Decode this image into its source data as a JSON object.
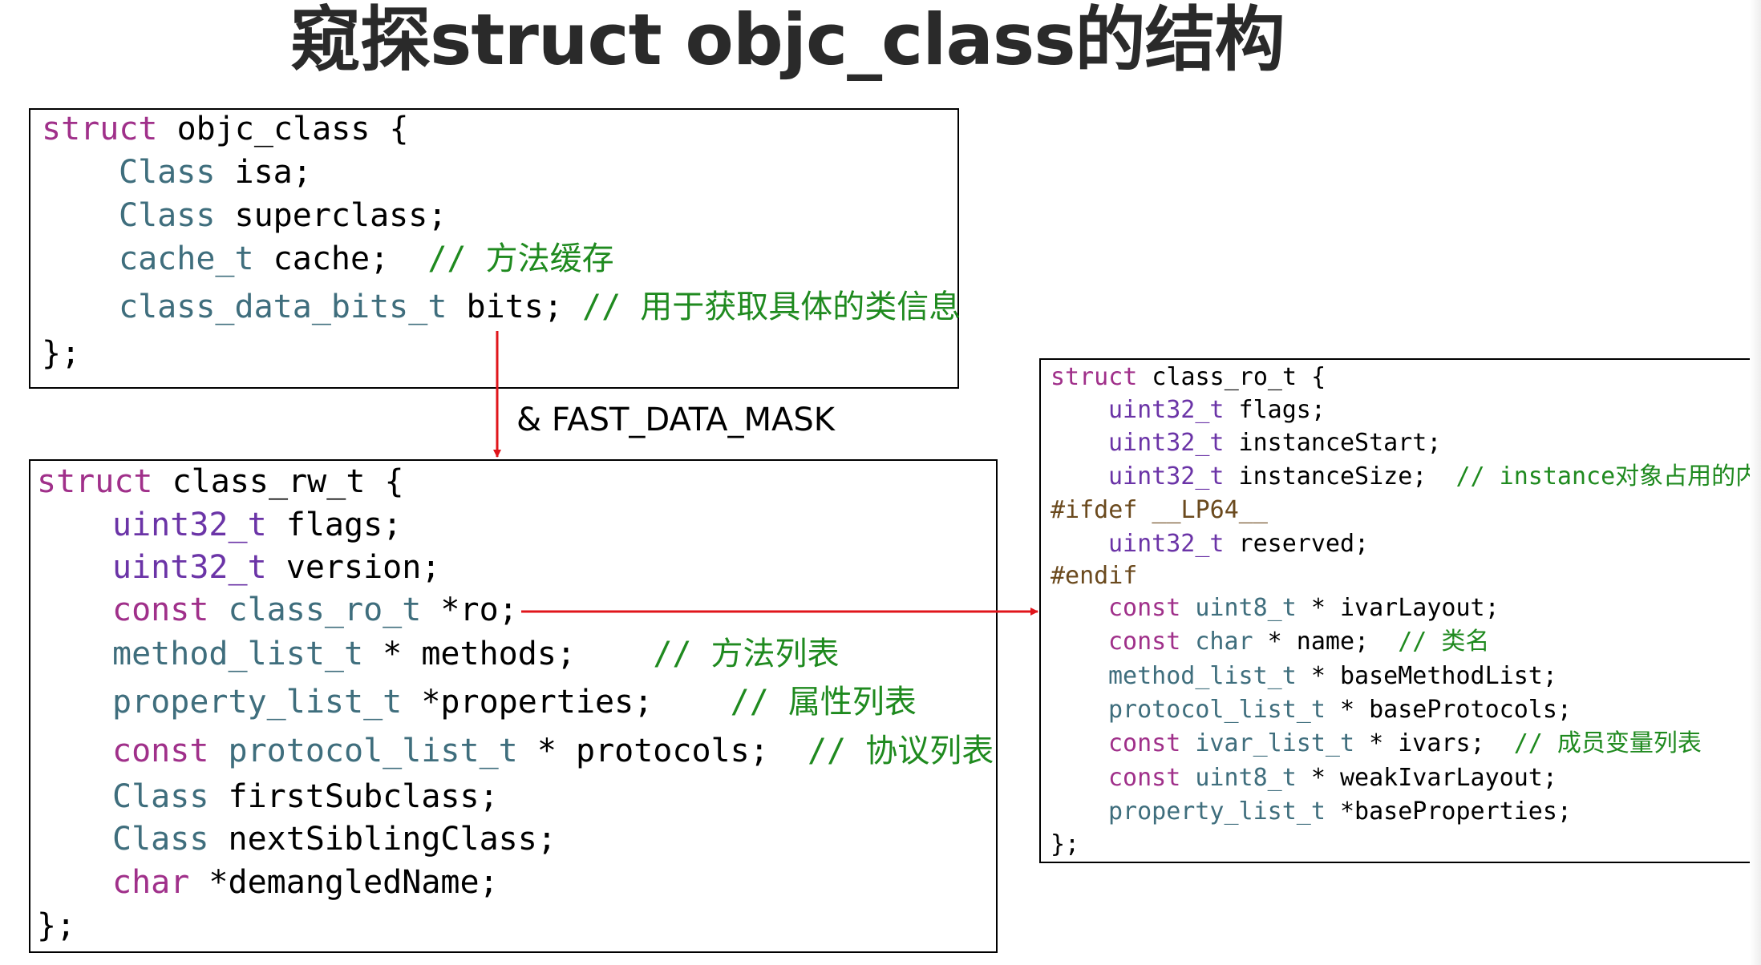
{
  "title": "窥探struct objc_class的结构",
  "arrow_label": "& FAST_DATA_MASK",
  "objc_class": {
    "l1_kw": "struct",
    "l1_rest": " objc_class {",
    "l2_type": "Class",
    "l2_rest": " isa;",
    "l3_type": "Class",
    "l3_rest": " superclass;",
    "l4_type": "cache_t",
    "l4_rest": " cache;  ",
    "l4_comment": "// 方法缓存",
    "l5_type": "class_data_bits_t",
    "l5_rest": " bits; ",
    "l5_comment": "// 用于获取具体的类信息",
    "l6": "};"
  },
  "class_rw_t": {
    "l1_kw": "struct",
    "l1_rest": " class_rw_t {",
    "l2_type": "uint32_t",
    "l2_rest": " flags;",
    "l3_type": "uint32_t",
    "l3_rest": " version;",
    "l4_kw": "const",
    "l4_type": " class_ro_t",
    "l4_rest": " *ro;",
    "l5_type": "method_list_t",
    "l5_rest": " * methods;    ",
    "l5_comment": "// 方法列表",
    "l6_type": "property_list_t",
    "l6_rest": " *properties;    ",
    "l6_comment": "// 属性列表",
    "l7_kw": "const",
    "l7_type": " protocol_list_t",
    "l7_rest": " * protocols;  ",
    "l7_comment": "// 协议列表",
    "l8_type": "Class",
    "l8_rest": " firstSubclass;",
    "l9_type": "Class",
    "l9_rest": " nextSiblingClass;",
    "l10_kw": "char",
    "l10_rest": " *demangledName;",
    "l11": "};"
  },
  "class_ro_t": {
    "l1_kw": "struct",
    "l1_rest": " class_ro_t {",
    "l2_type": "uint32_t",
    "l2_rest": " flags;",
    "l3_type": "uint32_t",
    "l3_rest": " instanceStart;",
    "l4_type": "uint32_t",
    "l4_rest": " instanceSize;  ",
    "l4_comment": "// instance对象占用的内",
    "l5": "#ifdef __LP64__",
    "l6_type": "uint32_t",
    "l6_rest": " reserved;",
    "l7": "#endif",
    "l8_kw": "const",
    "l8_type": " uint8_t",
    "l8_rest": " * ivarLayout;",
    "l9_kw": "const",
    "l9_type": " char",
    "l9_rest": " * name;  ",
    "l9_comment": "// 类名",
    "l10_type": "method_list_t",
    "l10_rest": " * baseMethodList;",
    "l11_type": "protocol_list_t",
    "l11_rest": " * baseProtocols;",
    "l12_kw": "const",
    "l12_type": " ivar_list_t",
    "l12_rest": " * ivars;  ",
    "l12_comment": "// 成员变量列表",
    "l13_kw": "const",
    "l13_type": " uint8_t",
    "l13_rest": " * weakIvarLayout;",
    "l14_type": "property_list_t",
    "l14_rest": " *baseProperties;",
    "l15": "};"
  },
  "colors": {
    "keyword": "#a0308a",
    "type": "#3f6e7d",
    "type_alt": "#6b34a7",
    "comment": "#1f8a1f",
    "preprocessor": "#6b4a1e",
    "arrow": "#e0151b"
  }
}
